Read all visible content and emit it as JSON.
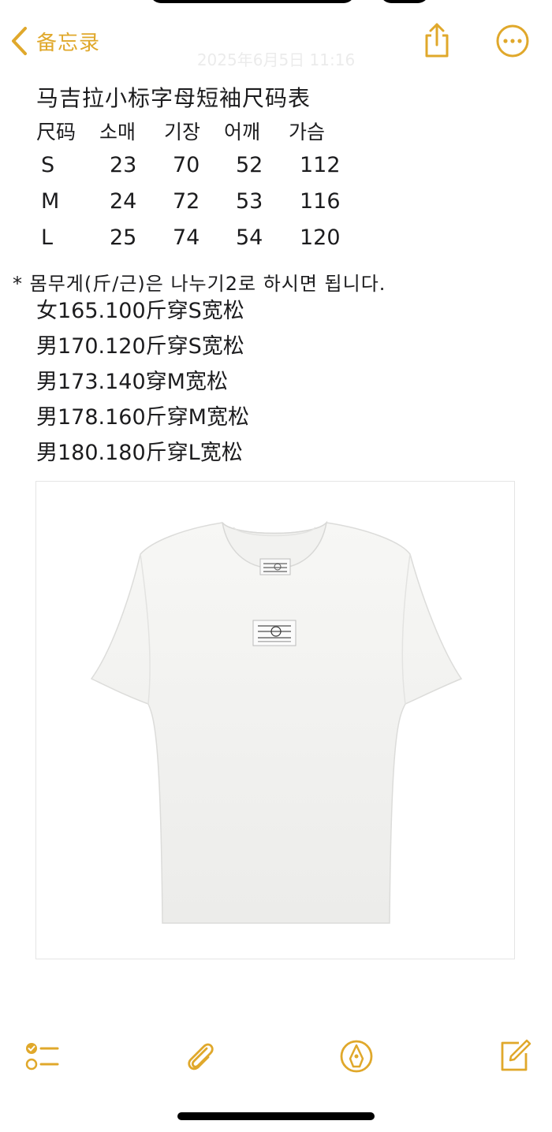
{
  "nav": {
    "back_label": "备忘录"
  },
  "note": {
    "date": "2025年6月5日 11:16",
    "title": "马吉拉小标字母短袖尺码表",
    "table": {
      "headers": [
        "尺码",
        "소매",
        "기장",
        "어깨",
        "가슴"
      ],
      "rows": [
        [
          "S",
          "23",
          "70",
          "52",
          "112"
        ],
        [
          "M",
          "24",
          "72",
          "53",
          "116"
        ],
        [
          "L",
          "25",
          "74",
          "54",
          "120"
        ]
      ]
    },
    "footnote": "* 몸무게(斤/근)은 나누기2로 하시면 됩니다.",
    "recommendations": [
      "女165.100斤穿S宽松",
      "男170.120斤穿S宽松",
      "男173.140穿M宽松",
      "男178.160斤穿M宽松",
      "男180.180斤穿L宽松"
    ],
    "photo": {
      "label_lines": [
        "0123456789",
        "101112131415",
        "MM6"
      ]
    }
  },
  "icons": {
    "back": "chevron-left-icon",
    "share": "share-icon",
    "more": "ellipsis-circle-icon",
    "checklist": "checklist-icon",
    "attach": "paperclip-icon",
    "markup": "pen-tip-circle-icon",
    "compose": "compose-icon"
  },
  "colors": {
    "accent": "#E0A82B",
    "text": "#1C1C1E",
    "background": "#FFFFFF"
  }
}
